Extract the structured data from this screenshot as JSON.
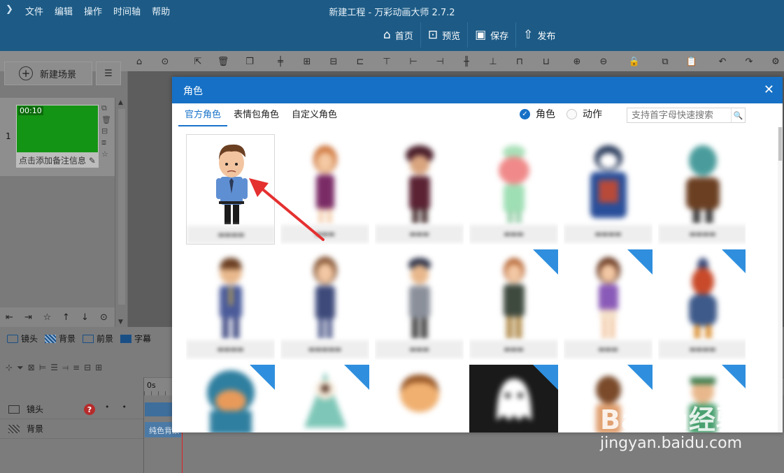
{
  "app": {
    "title": "新建工程 - 万彩动画大师 2.7.2",
    "menu": [
      "文件",
      "编辑",
      "操作",
      "时间轴",
      "帮助"
    ],
    "actions": [
      {
        "label": "首页",
        "icon": "home-icon"
      },
      {
        "label": "预览",
        "icon": "preview-icon"
      },
      {
        "label": "保存",
        "icon": "save-icon"
      },
      {
        "label": "发布",
        "icon": "publish-icon"
      }
    ]
  },
  "scene_panel": {
    "new_scene_label": "新建场景",
    "scene": {
      "number": "1",
      "duration": "00:10",
      "note": "点击添加备注信息"
    }
  },
  "timeline": {
    "tabs": [
      "镜头",
      "背景",
      "前景",
      "字幕"
    ],
    "ruler_start": "0s",
    "rows": [
      {
        "label": "镜头"
      },
      {
        "label": "背景"
      }
    ],
    "bg_bar_label": "纯色背景"
  },
  "dialog": {
    "title": "角色",
    "tabs": [
      "官方角色",
      "表情包角色",
      "自定义角色"
    ],
    "active_tab": "官方角色",
    "filter": {
      "role_label": "角色",
      "action_label": "动作",
      "selected": "角色"
    },
    "search_placeholder": "支持首字母快速搜索",
    "close_icon": "close-icon"
  },
  "colors": {
    "dialog_header": "#1671c6",
    "accent": "#1a73c9",
    "scene_thumb": "#149414",
    "arrow": "#e53030"
  },
  "watermark": {
    "logo": "Baidu经验",
    "url": "jingyan.baidu.com"
  }
}
